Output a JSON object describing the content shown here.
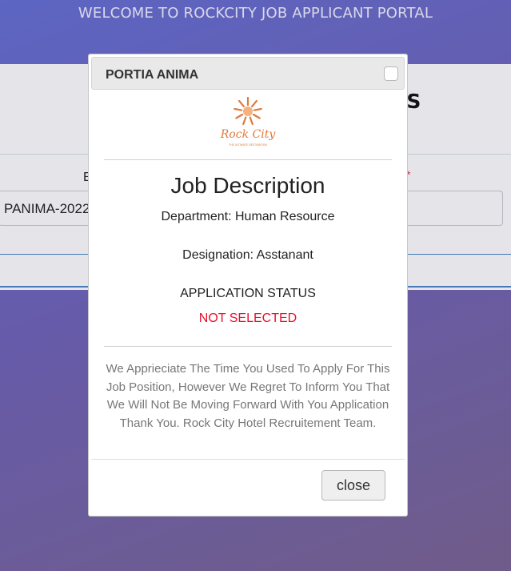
{
  "portal": {
    "title": "WELCOME TO ROCKCITY JOB APPLICANT PORTAL"
  },
  "background": {
    "heading": "CHECK APPLICATION STATUS",
    "field_label": "E",
    "required_mark": "*",
    "application_id_value": "PANIMA-2022"
  },
  "modal": {
    "title": "PORTIA ANIMA",
    "logo": {
      "name": "Rock City",
      "tagline": "THE ULTIMATE DESTINATION",
      "color": "#e07a3c"
    },
    "heading": "Job Description",
    "department": "Department: Human Resource",
    "designation": "Designation: Asstanant",
    "status_label": "APPLICATION STATUS",
    "status_value": "NOT SELECTED",
    "status_color": "#e8112d",
    "message": "We Apprieciate The Time You Used To Apply For This Job Position, However We Regret To Inform You That We Will Not Be Moving Forward With You Application Thank You. Rock City Hotel Recruitement Team.",
    "close_label": "close"
  }
}
